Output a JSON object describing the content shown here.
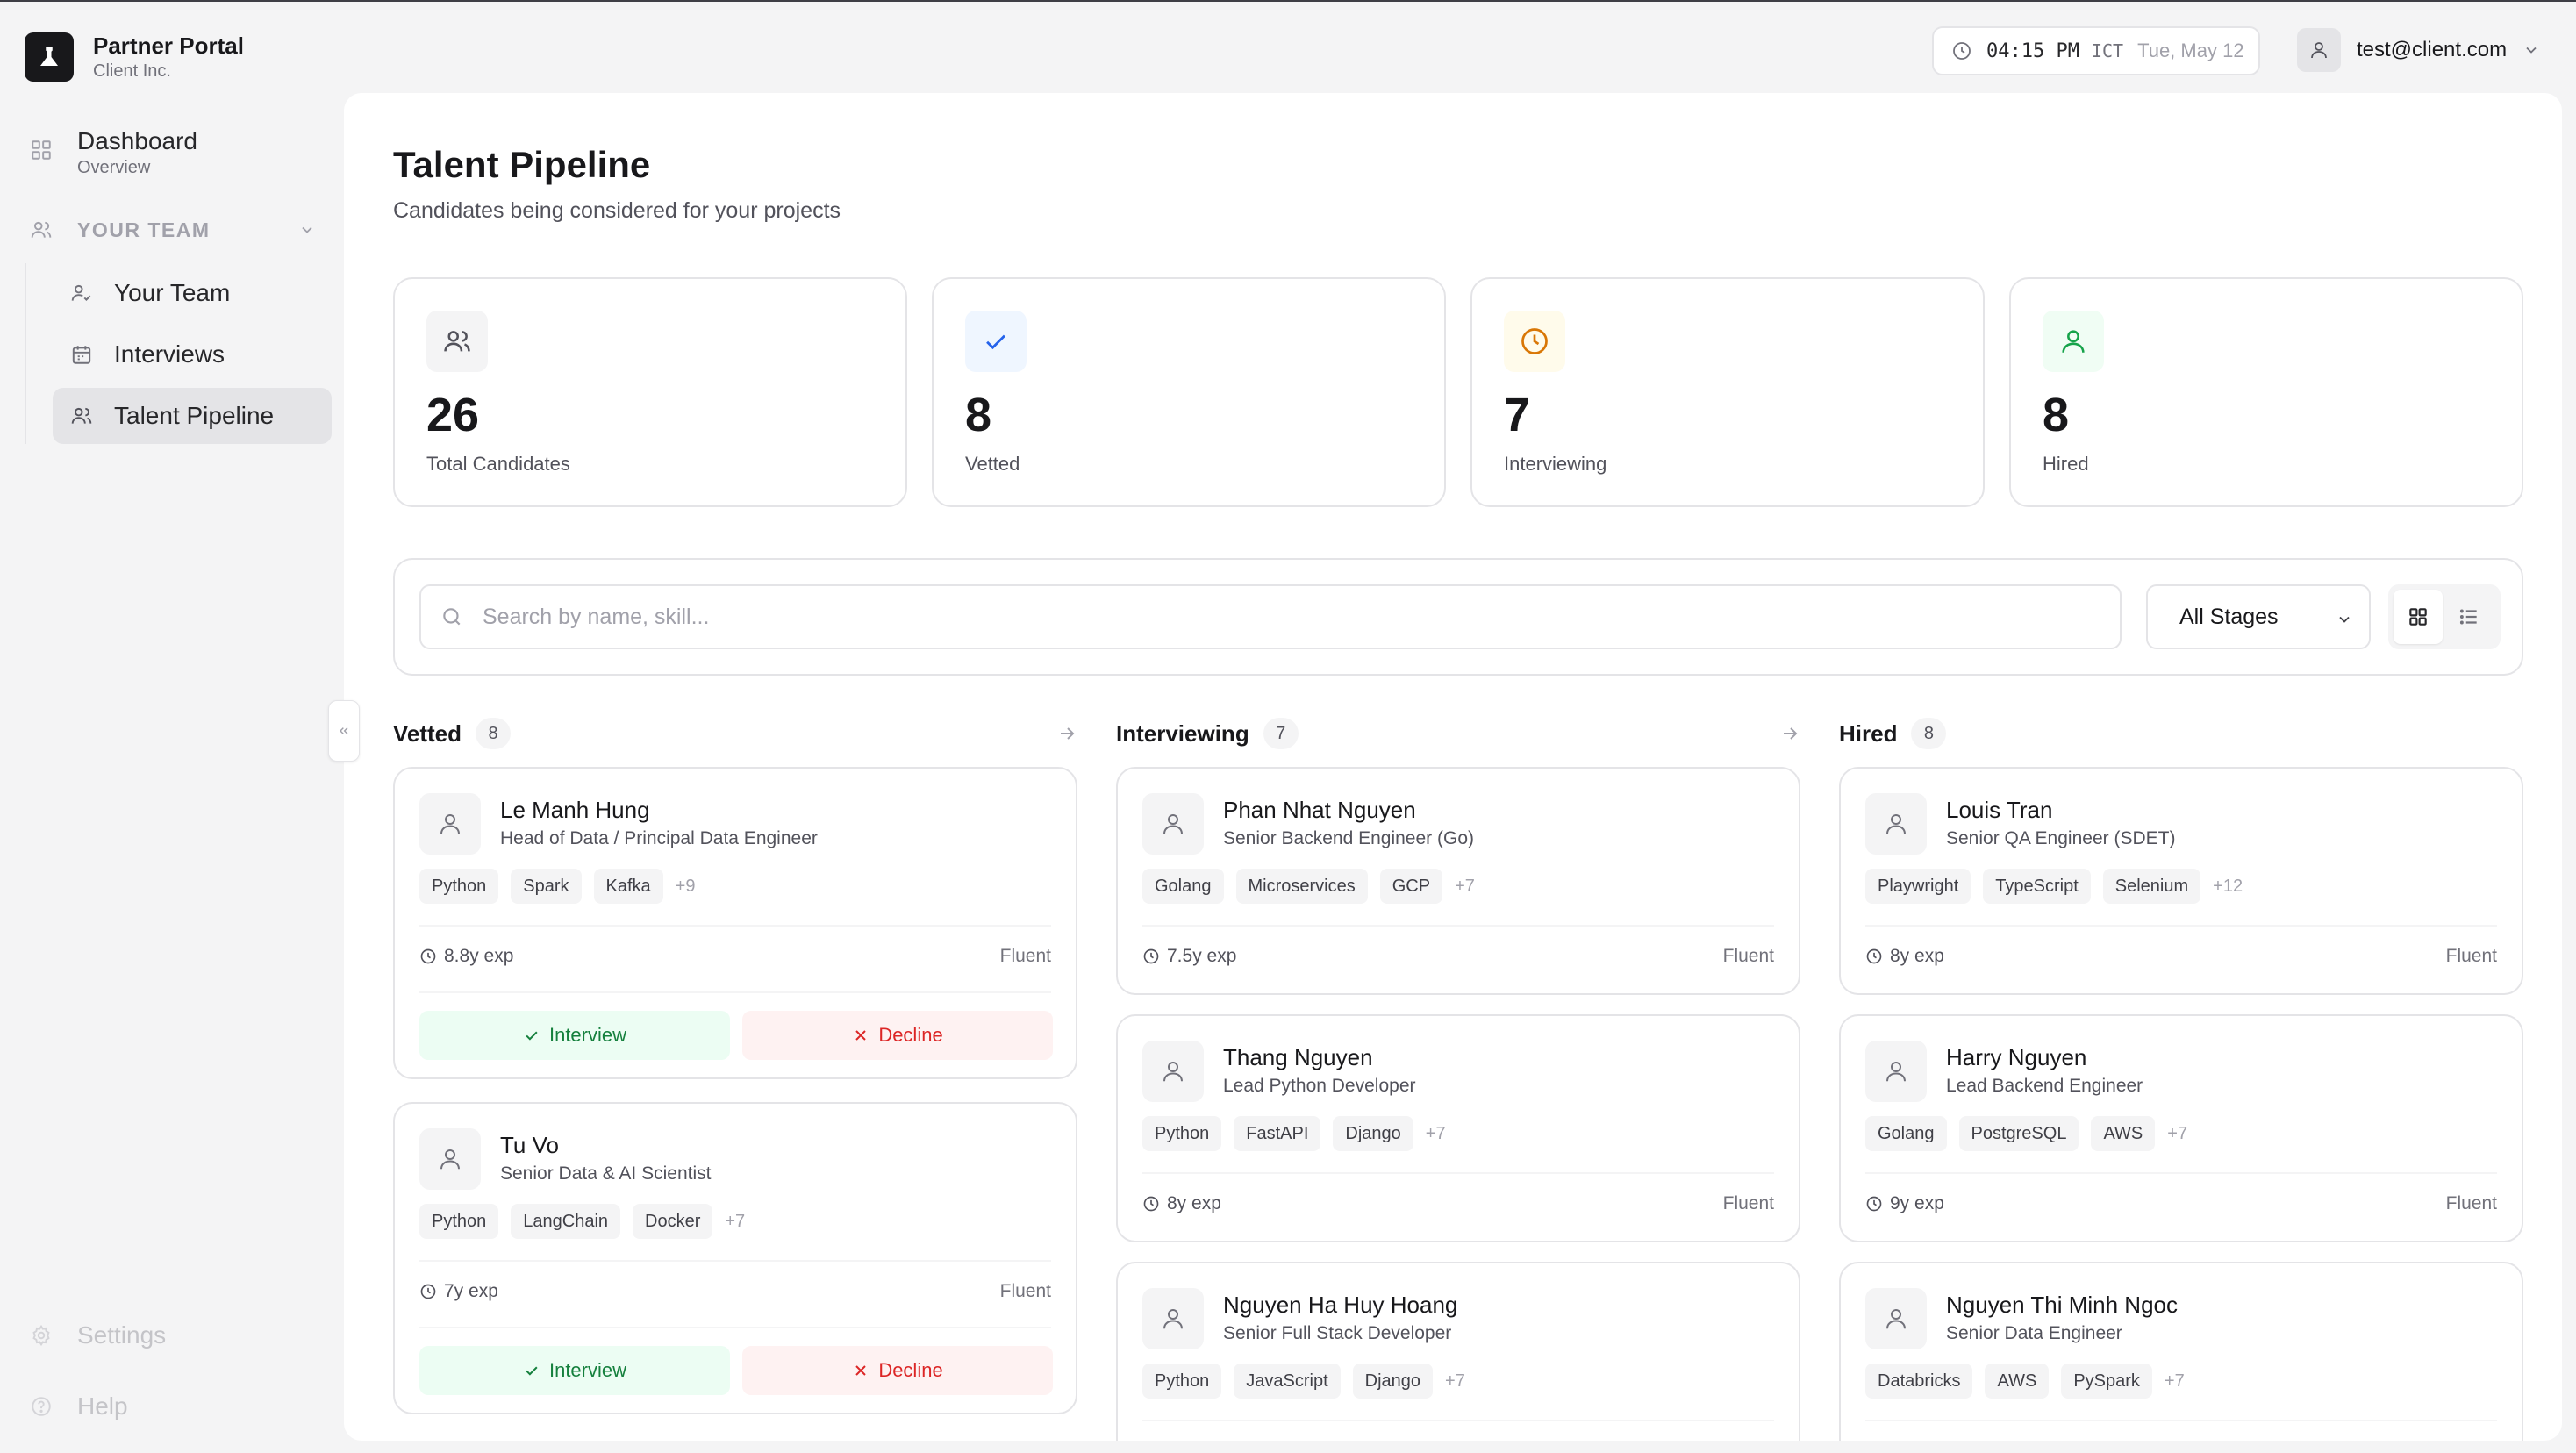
{
  "brand": {
    "title": "Partner Portal",
    "subtitle": "Client Inc."
  },
  "sidebar": {
    "dashboard": {
      "label": "Dashboard",
      "sub": "Overview"
    },
    "group": {
      "label": "YOUR TEAM"
    },
    "items": [
      {
        "label": "Your Team",
        "icon": "user-check-icon"
      },
      {
        "label": "Interviews",
        "icon": "calendar-icon"
      },
      {
        "label": "Talent Pipeline",
        "icon": "users-icon",
        "active": true
      }
    ],
    "footer": [
      {
        "label": "Settings",
        "icon": "gear-icon"
      },
      {
        "label": "Help",
        "icon": "help-circle-icon"
      }
    ]
  },
  "header": {
    "time": "04:15 PM",
    "timezone": "ICT",
    "date": "Tue, May 12",
    "user_email": "test@client.com"
  },
  "page": {
    "title": "Talent Pipeline",
    "subtitle": "Candidates being considered for your projects"
  },
  "stats": [
    {
      "value": "26",
      "label": "Total Candidates",
      "icon": "users-icon",
      "color": "#52525b"
    },
    {
      "value": "8",
      "label": "Vetted",
      "icon": "check-icon",
      "color": "#2563eb"
    },
    {
      "value": "7",
      "label": "Interviewing",
      "icon": "clock-icon",
      "color": "#d97706"
    },
    {
      "value": "8",
      "label": "Hired",
      "icon": "user-icon",
      "color": "#16a34a"
    }
  ],
  "filters": {
    "search_placeholder": "Search by name, skill...",
    "stage_selected": "All Stages"
  },
  "columns": [
    {
      "name": "Vetted",
      "count": "8",
      "cards": [
        {
          "name": "Le Manh Hung",
          "role": "Head of Data / Principal Data Engineer",
          "tags": [
            "Python",
            "Spark",
            "Kafka"
          ],
          "more": "+9",
          "exp": "8.8y exp",
          "english": "Fluent",
          "interview_label": "Interview",
          "decline_label": "Decline"
        },
        {
          "name": "Tu Vo",
          "role": "Senior Data & AI Scientist",
          "tags": [
            "Python",
            "LangChain",
            "Docker"
          ],
          "more": "+7",
          "exp": "7y exp",
          "english": "Fluent",
          "interview_label": "Interview",
          "decline_label": "Decline"
        }
      ]
    },
    {
      "name": "Interviewing",
      "count": "7",
      "cards": [
        {
          "name": "Phan Nhat Nguyen",
          "role": "Senior Backend Engineer (Go)",
          "tags": [
            "Golang",
            "Microservices",
            "GCP"
          ],
          "more": "+7",
          "exp": "7.5y exp",
          "english": "Fluent"
        },
        {
          "name": "Thang Nguyen",
          "role": "Lead Python Developer",
          "tags": [
            "Python",
            "FastAPI",
            "Django"
          ],
          "more": "+7",
          "exp": "8y exp",
          "english": "Fluent"
        },
        {
          "name": "Nguyen Ha Huy Hoang",
          "role": "Senior Full Stack Developer",
          "tags": [
            "Python",
            "JavaScript",
            "Django"
          ],
          "more": "+7"
        }
      ]
    },
    {
      "name": "Hired",
      "count": "8",
      "cards": [
        {
          "name": "Louis Tran",
          "role": "Senior QA Engineer (SDET)",
          "tags": [
            "Playwright",
            "TypeScript",
            "Selenium"
          ],
          "more": "+12",
          "exp": "8y exp",
          "english": "Fluent"
        },
        {
          "name": "Harry Nguyen",
          "role": "Lead Backend Engineer",
          "tags": [
            "Golang",
            "PostgreSQL",
            "AWS"
          ],
          "more": "+7",
          "exp": "9y exp",
          "english": "Fluent"
        },
        {
          "name": "Nguyen Thi Minh Ngoc",
          "role": "Senior Data Engineer",
          "tags": [
            "Databricks",
            "AWS",
            "PySpark"
          ],
          "more": "+7"
        }
      ]
    }
  ]
}
